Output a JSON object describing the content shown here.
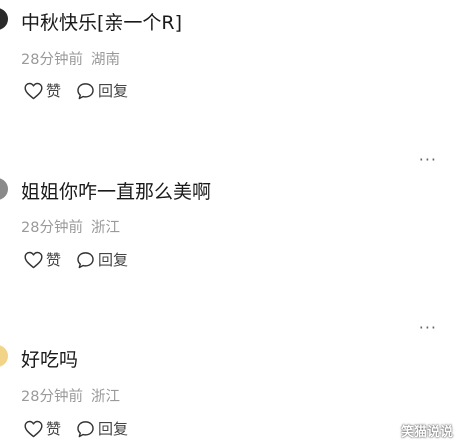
{
  "comments": [
    {
      "text": "中秋快乐[亲一个R]",
      "time": "28分钟前",
      "location": "湖南",
      "like_label": "赞",
      "reply_label": "回复",
      "avatar_color": "#2a2a2a"
    },
    {
      "text": "姐姐你咋一直那么美啊",
      "time": "28分钟前",
      "location": "浙江",
      "like_label": "赞",
      "reply_label": "回复",
      "more_label": "···",
      "avatar_color": "#8a8a8a"
    },
    {
      "text": "好吃吗",
      "time": "28分钟前",
      "location": "浙江",
      "like_label": "赞",
      "reply_label": "回复",
      "more_label": "···",
      "avatar_color": "#f2d488"
    }
  ],
  "watermark": "笑猫说说",
  "icons": {
    "like": "heart-outline-icon",
    "reply": "speech-bubble-icon",
    "more": "more-dots-icon"
  }
}
